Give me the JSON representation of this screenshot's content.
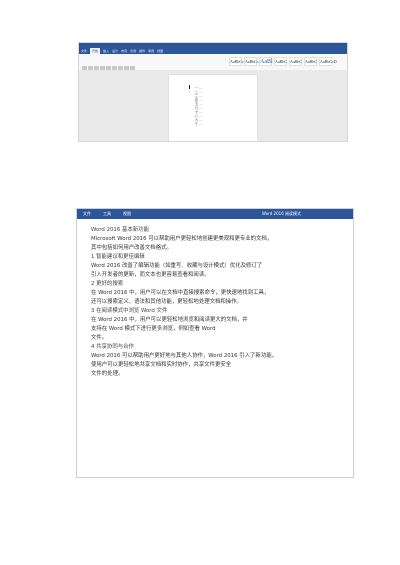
{
  "screenshot1": {
    "tabs": [
      "文件",
      "开始",
      "插入",
      "设计",
      "布局",
      "引用",
      "邮件",
      "审阅",
      "视图"
    ],
    "styles": [
      "AaBbCcDd",
      "AaBbCcDd",
      "AaBl",
      "AaBbC",
      "AaBbC",
      "AaBbC",
      "AaBbCcD"
    ],
    "nav_items": [
      "一 ...",
      "二 ...",
      "三 ...",
      "四 ...",
      "五 ...",
      "六 ...",
      "七 ...",
      "八 ...",
      "九 ...",
      "十 ..."
    ]
  },
  "screenshot2": {
    "tabs": [
      "文件",
      "工具",
      "视图"
    ],
    "window_title": "Word 2016 阅读模式",
    "lines": [
      "Word 2016 基本新功能",
      "Microsoft Word 2016 可以帮助用户更轻松地创建更美观和更专业的文档，",
      "其中包括如何用户改善文档格式。",
      "1 智能建议和更佳编辑",
      "Word 2016 改善了编辑功能（如重写、收藏与设计模式）优化及修订了",
      "引入开发者的更新，而文本也更容易查看和阅读。",
      "2 更好的搜索",
      "在 Word 2016 中，用户可以在文档中直接搜索命令，更快速地找到工具，",
      "还可以搜索定义、语法和其他功能，更轻松地处理文档和操作。",
      "3 在阅读模式中浏览 Word 文件",
      "在 Word 2016 中，用户可以更轻松地浏览和阅读更大的文档，并",
      "支持在 Word 模式下进行更多浏览，例如查看 Word",
      "文件。",
      "4 共享协同与合作",
      "Word 2016 可以帮助用户更好地与其他人协作，Word 2016 引入了新功能，",
      "使用户可以更轻松地共享文档和实时协作，共享文件更安全",
      "文件的处理。"
    ]
  }
}
